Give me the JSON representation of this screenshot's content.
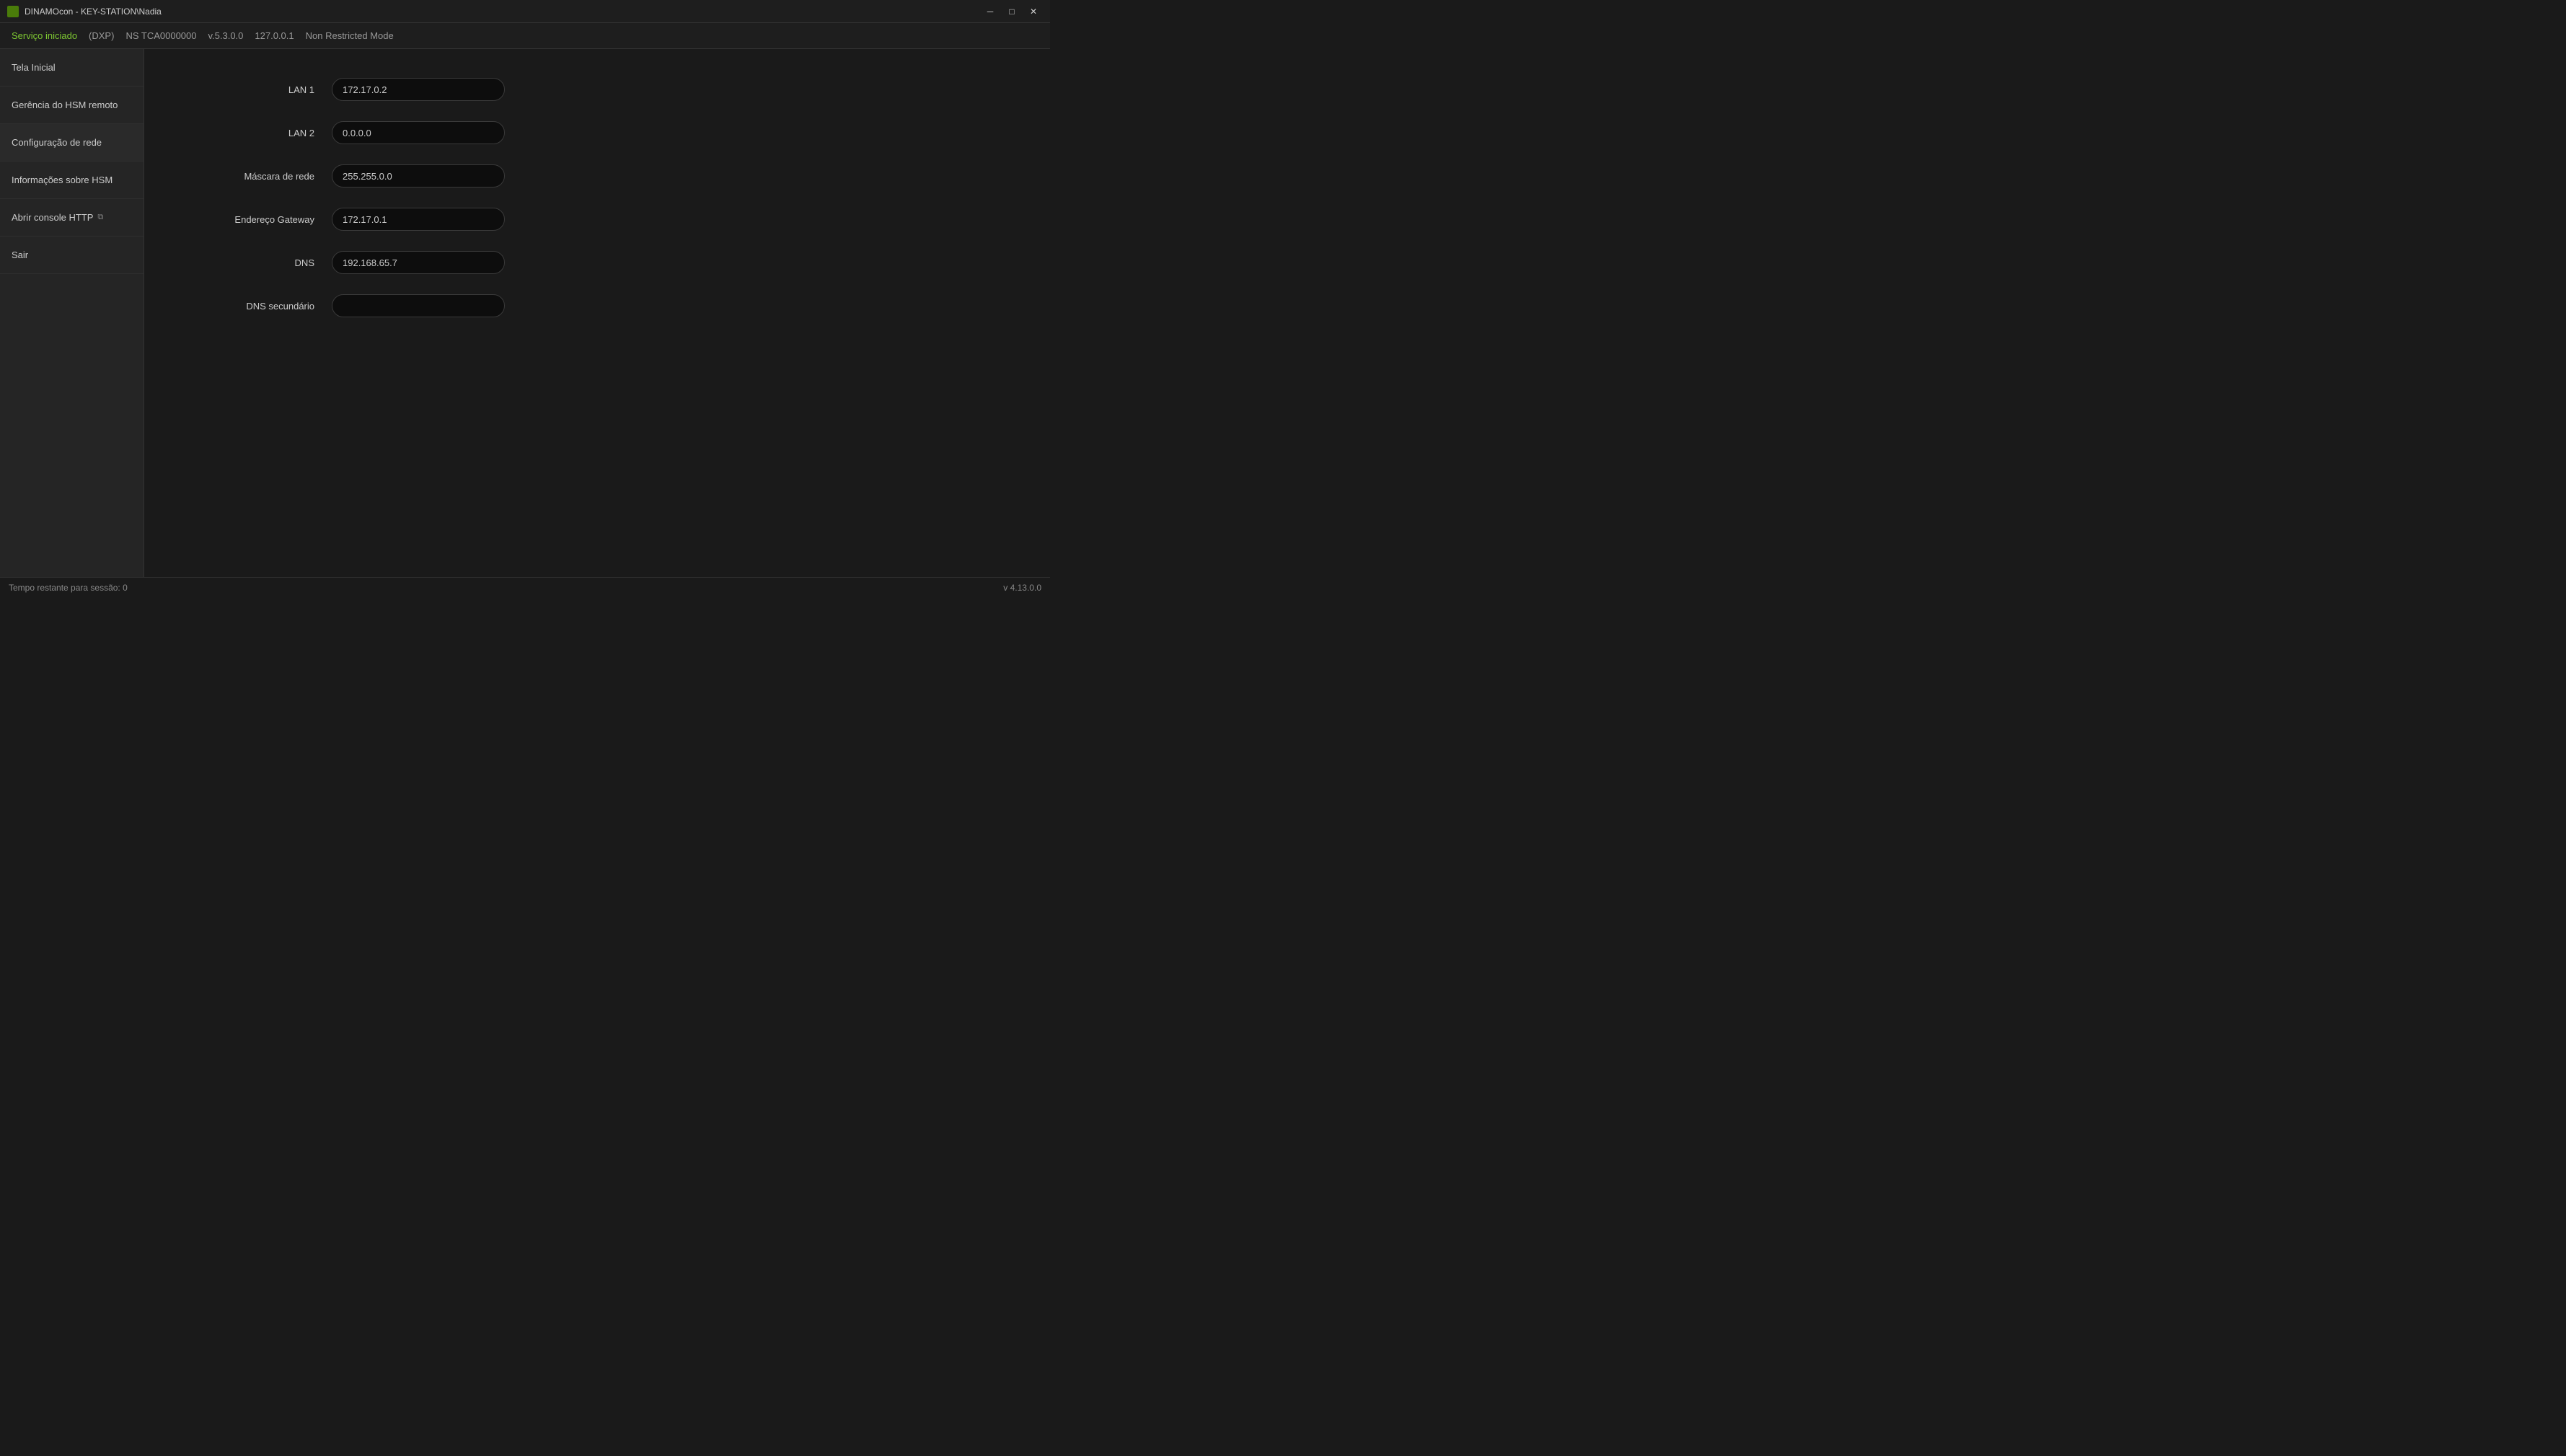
{
  "titleBar": {
    "icon": "D",
    "title": "DINAMOcon - KEY-STATION\\Nadia",
    "minimizeLabel": "─",
    "maximizeLabel": "□",
    "closeLabel": "✕"
  },
  "statusTop": {
    "service": "Serviço iniciado",
    "dxp": "(DXP)",
    "ns": "NS TCA0000000",
    "version": "v.5.3.0.0",
    "ip": "127.0.0.1",
    "mode": "Non Restricted Mode"
  },
  "sidebar": {
    "items": [
      {
        "id": "tela-inicial",
        "label": "Tela Inicial",
        "hasIcon": false
      },
      {
        "id": "gerencia-hsm",
        "label": "Gerência do HSM remoto",
        "hasIcon": false
      },
      {
        "id": "config-rede",
        "label": "Configuração de rede",
        "hasIcon": false,
        "active": true
      },
      {
        "id": "info-hsm",
        "label": "Informações sobre HSM",
        "hasIcon": false
      },
      {
        "id": "abrir-console",
        "label": "Abrir console HTTP",
        "hasIcon": true
      },
      {
        "id": "sair",
        "label": "Sair",
        "hasIcon": false
      }
    ]
  },
  "form": {
    "fields": [
      {
        "id": "lan1",
        "label": "LAN 1",
        "value": "172.17.0.2"
      },
      {
        "id": "lan2",
        "label": "LAN 2",
        "value": "0.0.0.0"
      },
      {
        "id": "mascara",
        "label": "Máscara de rede",
        "value": "255.255.0.0"
      },
      {
        "id": "gateway",
        "label": "Endereço Gateway",
        "value": "172.17.0.1"
      },
      {
        "id": "dns",
        "label": "DNS",
        "value": "192.168.65.7"
      },
      {
        "id": "dns2",
        "label": "DNS secundário",
        "value": ""
      }
    ]
  },
  "statusBottom": {
    "sessionLabel": "Tempo restante para sessão:",
    "sessionValue": "0",
    "version": "v 4.13.0.0"
  }
}
